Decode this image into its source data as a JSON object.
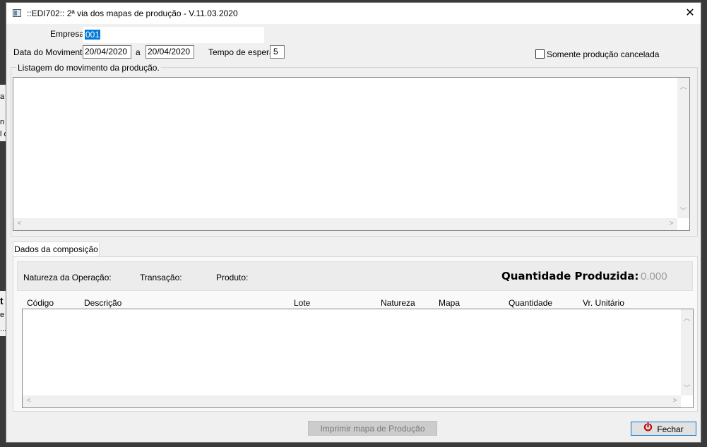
{
  "window": {
    "title": "::EDI702:: 2ª via dos mapas de produção - V.11.03.2020"
  },
  "background_fragments": [
    "a",
    "n",
    "l c",
    "t",
    "e",
    "..."
  ],
  "form": {
    "empresa_label": "Empresa:",
    "empresa_value": "001",
    "data_movimento_label": "Data do Movimento:",
    "data_inicio": "20/04/2020",
    "data_separator": "a",
    "data_fim": "20/04/2020",
    "tempo_espera_label": "Tempo de espera:",
    "tempo_espera_value": "5",
    "somente_cancelada_label": "Somente produção cancelada",
    "somente_cancelada_checked": false
  },
  "listagem": {
    "label": "Listagem do movimento da produção."
  },
  "composicao": {
    "tab_label": "Dados da composição",
    "natureza_label": "Natureza da Operação:",
    "transacao_label": "Transação:",
    "produto_label": "Produto:",
    "quantidade_label": "Quantidade Produzida:",
    "quantidade_value": "0.000",
    "columns": [
      "Código",
      "Descrição",
      "Lote",
      "Natureza",
      "Mapa",
      "Quantidade",
      "Vr. Unitário"
    ],
    "rows": []
  },
  "buttons": {
    "imprimir_label": "Imprimir mapa de Produção",
    "fechar_label": "Fechar"
  },
  "colors": {
    "fechar_icon": "#c00000",
    "disabled_text": "#7a7a7a",
    "selection": "#0078d7"
  }
}
